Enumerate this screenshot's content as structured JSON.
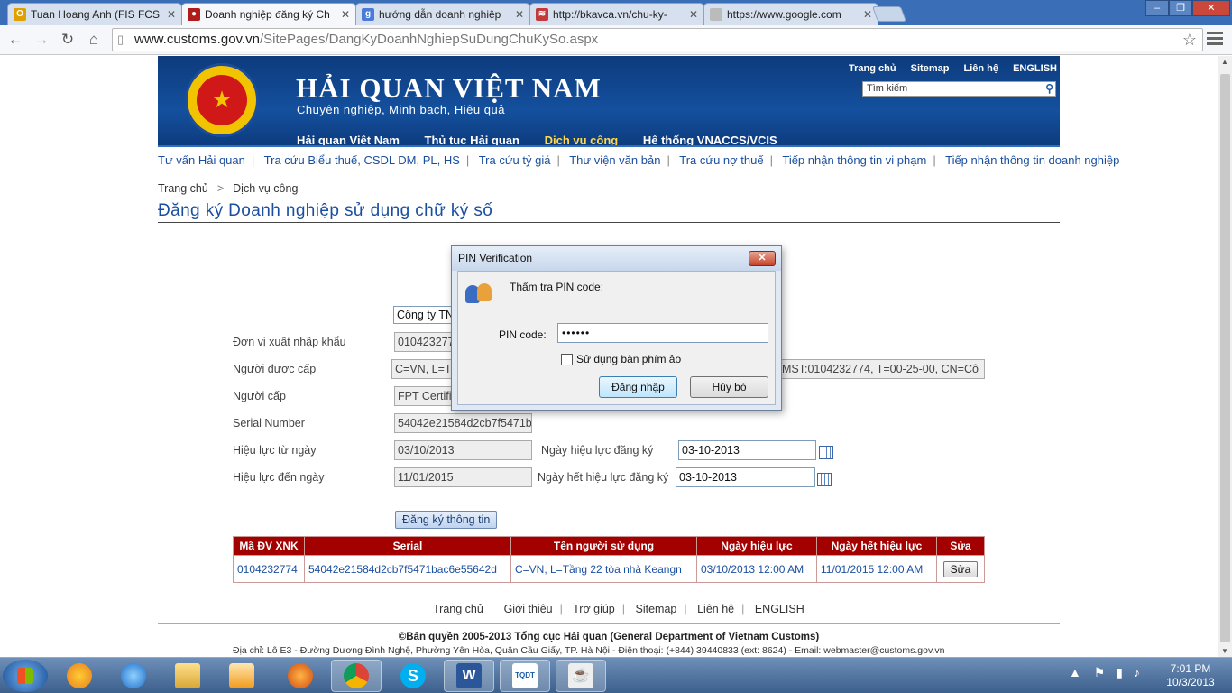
{
  "browser": {
    "tabs": [
      {
        "title": "Tuan Hoang Anh (FIS FCS",
        "icon_color": "#e0a000"
      },
      {
        "title": "Doanh nghiệp đăng ký Ch",
        "icon_color": "#b01c1c"
      },
      {
        "title": "hướng dẫn doanh nghiệp",
        "icon_color": "#4a7bd8"
      },
      {
        "title": "http://bkavca.vn/chu-ky-",
        "icon_color": "#c43a3a"
      },
      {
        "title": "https://www.google.com",
        "icon_color": "#bbbbbb"
      }
    ],
    "url_host": "www.customs.gov.vn",
    "url_path": "/SitePages/DangKyDoanhNghiepSuDungChuKySo.aspx"
  },
  "header": {
    "brand": "HẢI QUAN VIỆT NAM",
    "slogan": "Chuyên nghiệp, Minh bạch, Hiệu quả",
    "topnav": [
      "Trang chủ",
      "Sitemap",
      "Liên hệ",
      "ENGLISH"
    ],
    "search_placeholder": "Tìm kiếm",
    "mainnav": [
      "Hải quan Việt Nam",
      "Thủ tục Hải quan",
      "Dịch vụ công",
      "Hệ thống VNACCS/VCIS"
    ],
    "active_color": "#ffd84d"
  },
  "subnav": [
    "Tư vấn Hải quan",
    "Tra cứu Biểu thuế, CSDL DM, PL, HS",
    "Tra cứu tỷ giá",
    "Thư viện văn bản",
    "Tra cứu nợ thuế",
    "Tiếp nhận thông tin vi phạm",
    "Tiếp nhận thông tin doanh nghiệp"
  ],
  "breadcrumb": [
    "Trang chủ",
    "Dịch vụ công"
  ],
  "page_title": "Đăng ký Doanh nghiệp sử dụng chữ ký số",
  "form": {
    "company_select": "Công ty TN",
    "labels": [
      "Đơn vị xuất nhập khẩu",
      "Người được cấp",
      "Người cấp",
      "Serial Number",
      "Hiệu lực từ ngày",
      "Hiệu lực đến ngày"
    ],
    "values": {
      "unit": "0104232774",
      "issued_to": "C=VN, L=T",
      "issued_to_tail": "MST:0104232774, T=00-25-00, CN=Cô",
      "issuer": "FPT Certifi",
      "serial": "54042e21584d2cb7f5471b",
      "valid_from": "03/10/2013",
      "valid_to": "11/01/2015"
    },
    "reg_from_label": "Ngày hiệu lực đăng ký",
    "reg_from": "03-10-2013",
    "reg_to_label": "Ngày hết hiệu lực đăng ký",
    "reg_to": "03-10-2013",
    "submit": "Đăng ký thông tin"
  },
  "table": {
    "headers": [
      "Mã ĐV XNK",
      "Serial",
      "Tên người sử dụng",
      "Ngày hiệu lực",
      "Ngày hết hiệu lực",
      "Sửa"
    ],
    "row": [
      "0104232774",
      "54042e21584d2cb7f5471bac6e55642d",
      "C=VN, L=Tầng 22 tòa nhà Keangn",
      "03/10/2013 12:00 AM",
      "11/01/2015 12:00 AM",
      "Sửa"
    ]
  },
  "footer": {
    "nav": [
      "Trang chủ",
      "Giới thiệu",
      "Trợ giúp",
      "Sitemap",
      "Liên hệ",
      "ENGLISH"
    ],
    "copyright": "©Bản quyền 2005-2013 Tổng cục Hải quan (General Department of Vietnam Customs)",
    "address": "Địa chỉ: Lô E3 - Đường Dương Đình Nghệ, Phường Yên Hòa, Quận Cầu Giấy, TP. Hà Nội  -  Điện thoại: (+844) 39440833 (ext: 8624)  -  Email: webmaster@customs.gov.vn"
  },
  "dialog": {
    "title": "PIN Verification",
    "heading": "Thẩm tra PIN code:",
    "pin_label": "PIN code:",
    "pin_value": "••••••",
    "checkbox_label": "Sử dụng bàn phím ảo",
    "ok": "Đăng nhập",
    "cancel": "Hủy bỏ"
  },
  "taskbar": {
    "time": "7:01 PM",
    "date": "10/3/2013",
    "apps": [
      "chrome-canary",
      "internet-explorer",
      "file-explorer",
      "media-player",
      "firefox",
      "chrome",
      "skype",
      "word",
      "fpt-tqdt",
      "java"
    ]
  }
}
